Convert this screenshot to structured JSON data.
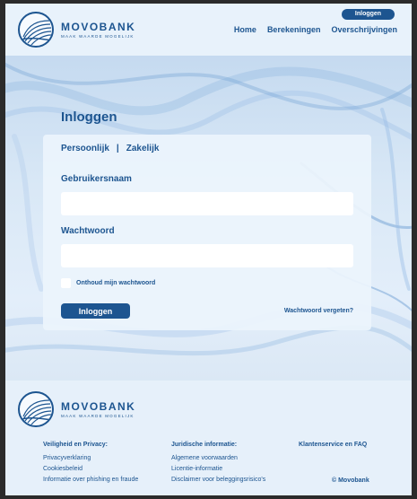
{
  "header": {
    "login_button": "Inloggen",
    "brand": {
      "name": "MOVOBANK",
      "tagline": "MAAK WAARDE MOGELIJK"
    },
    "nav": [
      "Home",
      "Berekeningen",
      "Overschrijvingen"
    ]
  },
  "login": {
    "title": "Inloggen",
    "tabs": [
      "Persoonlijk",
      "Zakelijk"
    ],
    "tab_separator": "|",
    "username_label": "Gebruikersnaam",
    "username_value": "",
    "password_label": "Wachtwoord",
    "password_value": "",
    "remember_label": "Onthoud mijn wachtwoord",
    "submit_label": "Inloggen",
    "forgot_label": "Wachtwoord vergeten?"
  },
  "footer": {
    "brand": {
      "name": "MOVOBANK",
      "tagline": "MAAK WAARDE MOGELIJK"
    },
    "columns": [
      {
        "heading": "Veiligheid en Privacy:",
        "links": [
          "Privacyverklaring",
          "Cookiesbeleid",
          "Informatie over phishing en fraude"
        ]
      },
      {
        "heading": "Juridische informatie:",
        "links": [
          "Algemene voorwaarden",
          "Licentie-informatie",
          "Disclaimer voor beleggingsrisico's"
        ]
      },
      {
        "heading": "Klantenservice en FAQ",
        "links": []
      }
    ],
    "copyright": "© Movobank"
  },
  "colors": {
    "brand": "#1d5590",
    "background": "#eaf3fc"
  },
  "icons": {
    "logo": "wave-globe-logo-icon",
    "checkbox": "checkbox-icon"
  }
}
